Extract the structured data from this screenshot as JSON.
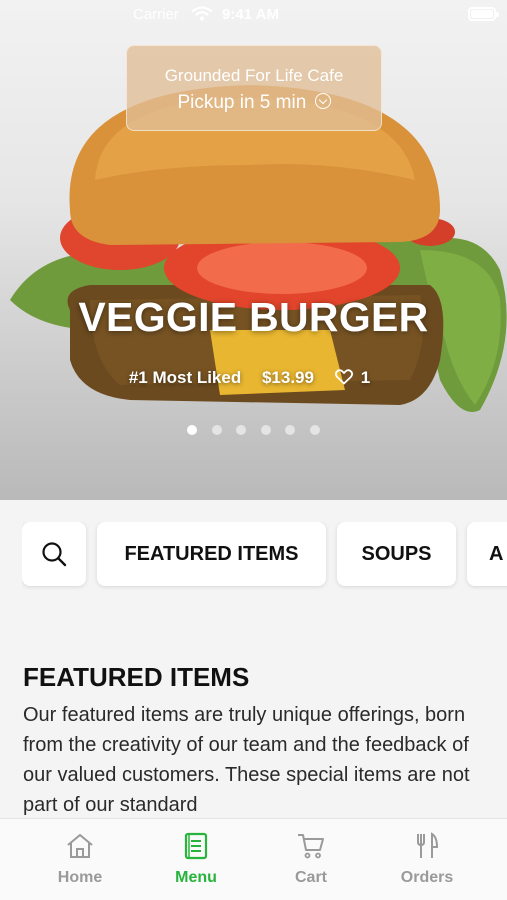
{
  "status": {
    "carrier": "Carrier",
    "time": "9:41 AM"
  },
  "pickup": {
    "cafe_name": "Grounded For Life Cafe",
    "time_label": "Pickup in 5 min"
  },
  "hero": {
    "item_name": "VEGGIE BURGER",
    "tag": "#1 Most Liked",
    "price": "$13.99",
    "likes": "1",
    "slide_count": 6,
    "active_slide": 1
  },
  "categories": [
    {
      "icon": "search-icon"
    },
    {
      "label": "FEATURED ITEMS"
    },
    {
      "label": "SOUPS"
    },
    {
      "label": "A"
    }
  ],
  "featured": {
    "title": "FEATURED ITEMS",
    "description": "Our featured items are truly unique offerings, born from the creativity of our team and the feedback of our valued customers. These special items are not part of our standard"
  },
  "tabs": [
    {
      "label": "Home",
      "icon": "home-icon"
    },
    {
      "label": "Menu",
      "icon": "menu-icon",
      "active": true
    },
    {
      "label": "Cart",
      "icon": "cart-icon"
    },
    {
      "label": "Orders",
      "icon": "orders-icon"
    }
  ],
  "colors": {
    "accent": "#28b43c",
    "inactive_tab": "#9a9a9a"
  }
}
